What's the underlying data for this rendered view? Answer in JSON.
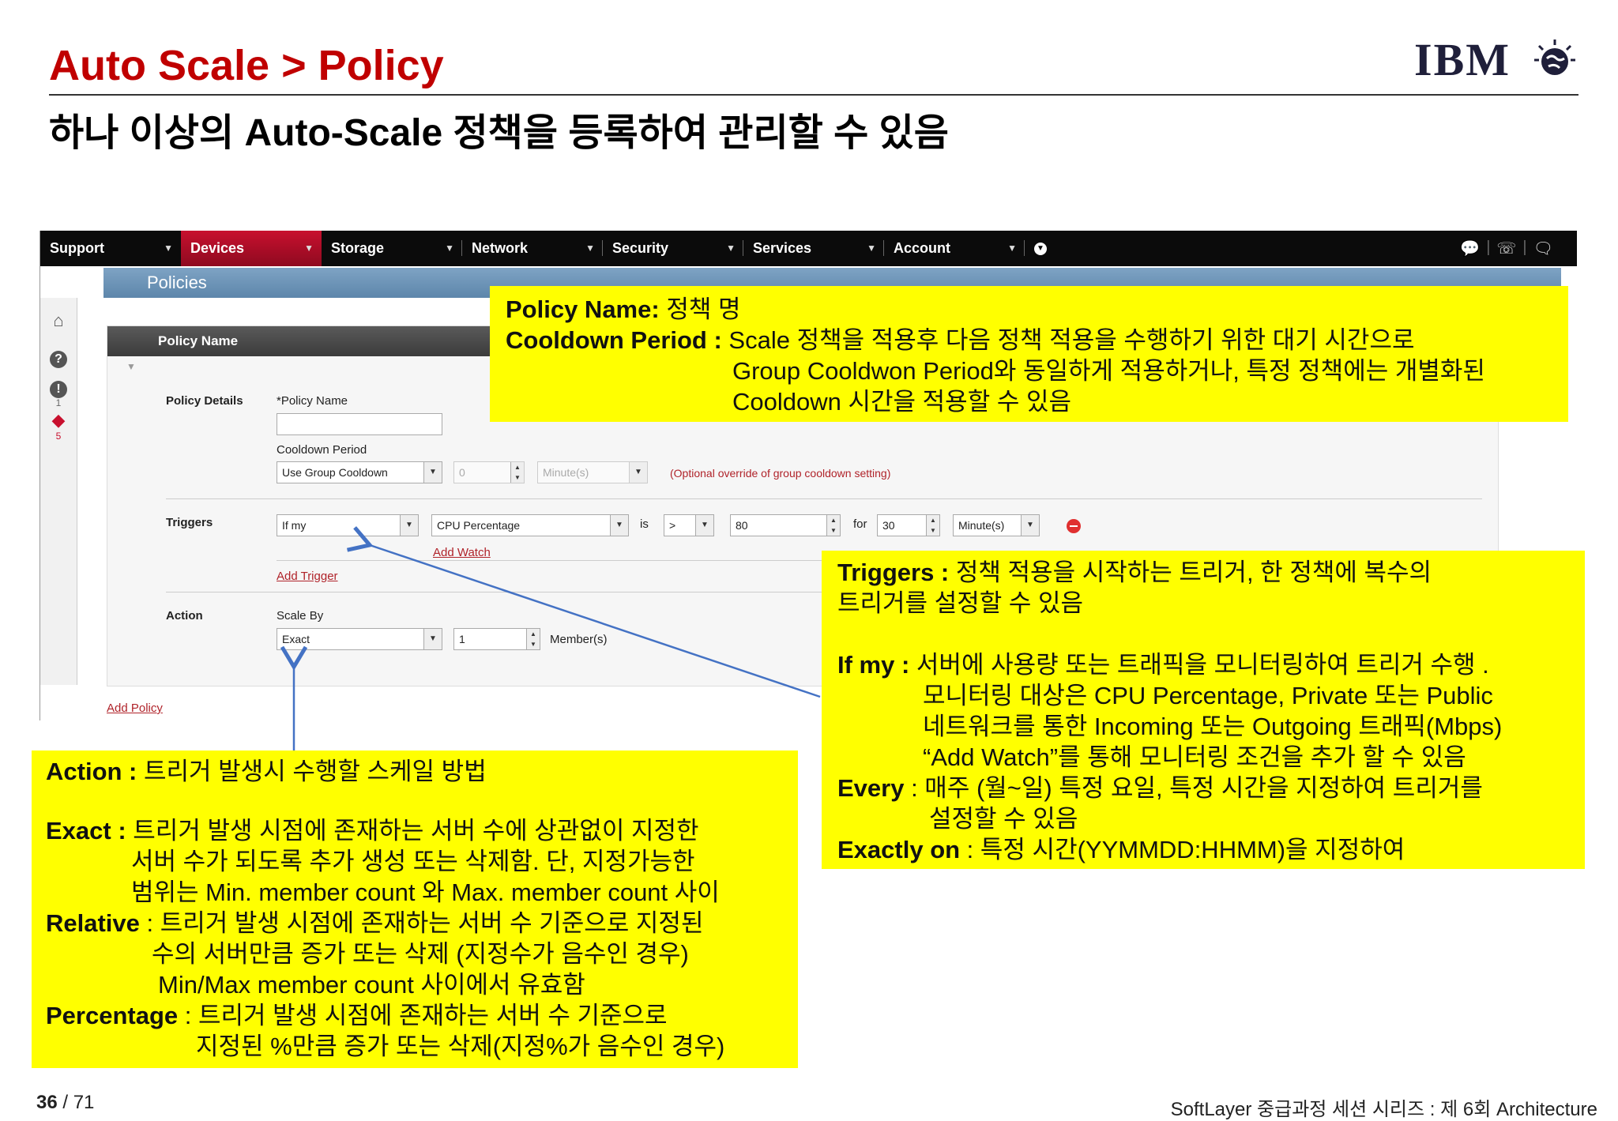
{
  "header": {
    "title": "Auto Scale > Policy",
    "subtitle": "하나 이상의 Auto-Scale 정책을 등록하여 관리할 수 있음",
    "logo_text": "IBM",
    "logo_icon": "globe-icon"
  },
  "navbar": {
    "items": [
      "Support",
      "Devices",
      "Storage",
      "Network",
      "Security",
      "Services",
      "Account"
    ],
    "active": "Devices",
    "right_icons": [
      "chat-icon",
      "phone-icon",
      "speech-icon"
    ]
  },
  "policies_bar": {
    "title": "Policies"
  },
  "side_icons": [
    {
      "icon": "home-icon",
      "count": ""
    },
    {
      "icon": "help-icon",
      "count": ""
    },
    {
      "icon": "alert-icon",
      "count": "1"
    },
    {
      "icon": "tag-icon",
      "count": "5"
    }
  ],
  "form": {
    "panel_header": "Policy Name",
    "policy_details_label": "Policy Details",
    "policy_name_label": "*Policy Name",
    "policy_name_value": "",
    "cooldown_label": "Cooldown Period",
    "cooldown_select": "Use Group Cooldown",
    "cooldown_value": "0",
    "cooldown_unit": "Minute(s)",
    "cooldown_note": "(Optional override of group cooldown setting)",
    "triggers_label": "Triggers",
    "trigger": {
      "type": "If my",
      "metric": "CPU Percentage",
      "is_label": "is",
      "operator": ">",
      "threshold": "80",
      "for_label": "for",
      "duration": "30",
      "unit": "Minute(s)"
    },
    "add_watch": "Add Watch",
    "add_trigger": "Add Trigger",
    "action_label": "Action",
    "scale_by_label": "Scale By",
    "scale_by_value": "Exact",
    "member_value": "1",
    "member_label": "Member(s)",
    "add_policy": "Add Policy"
  },
  "callout_policy": {
    "lines": [
      {
        "bold": "Policy Name:",
        "text": " 정책 명"
      },
      {
        "bold": "Cooldown Period :",
        "text": " Scale 정책을 적용후 다음 정책 적용을 수행하기 위한 대기 시간으로"
      },
      {
        "bold": "",
        "text": "Group Cooldwon Period와 동일하게 적용하거나, 특정 정책에는 개별화된"
      },
      {
        "bold": "",
        "text": "Cooldown 시간을 적용할 수 있음"
      }
    ]
  },
  "callout_triggers": {
    "lines": [
      {
        "bold": "Triggers :",
        "text": " 정책 적용을 시작하는 트리거, 한 정책에 복수의"
      },
      {
        "bold": "",
        "text": "트리거를 설정할 수 있음"
      },
      {
        "bold": "",
        "text": ""
      },
      {
        "bold": "If my :",
        "text": "  서버에 사용량 또는 트래픽을 모니터링하여 트리거 수행 ."
      },
      {
        "bold": "",
        "text": "모니터링 대상은 CPU Percentage, Private 또는 Public"
      },
      {
        "bold": "",
        "text": "네트워크를 통한 Incoming 또는 Outgoing 트래픽(Mbps)"
      },
      {
        "bold": "",
        "text": " “Add Watch”를 통해 모니터링 조건을 추가 할 수 있음"
      },
      {
        "bold": "Every",
        "text": " : 매주 (월~일) 특정 요일, 특정 시간을 지정하여 트리거를"
      },
      {
        "bold": "",
        "text": "설정할 수 있음"
      },
      {
        "bold": "Exactly on",
        "text": " : 특정 시간(YYMMDD:HHMM)을 지정하여"
      }
    ]
  },
  "callout_action": {
    "lines": [
      {
        "bold": "Action :",
        "text": " 트리거 발생시 수행할 스케일 방법"
      },
      {
        "bold": "",
        "text": ""
      },
      {
        "bold": "Exact :",
        "text": " 트리거 발생 시점에 존재하는 서버 수에 상관없이 지정한"
      },
      {
        "bold": "",
        "text": "서버 수가 되도록 추가 생성 또는 삭제함. 단, 지정가능한"
      },
      {
        "bold": "",
        "text": "범위는 Min. member count 와 Max. member count 사이"
      },
      {
        "bold": "Relative",
        "text": " : 트리거 발생 시점에 존재하는 서버 수 기준으로 지정된"
      },
      {
        "bold": "",
        "text": "수의 서버만큼 증가 또는 삭제 (지정수가 음수인 경우)"
      },
      {
        "bold": "",
        "text": "Min/Max member count  사이에서 유효함"
      },
      {
        "bold": "Percentage",
        "text": " : 트리거 발생 시점에 존재하는 서버 수 기준으로"
      },
      {
        "bold": "",
        "text": "지정된 %만큼 증가 또는 삭제(지정%가 음수인 경우)"
      }
    ]
  },
  "footer": {
    "page": "36",
    "total": " / 71",
    "series": "SoftLayer 중급과정 세션 시리즈 : 제 6회 Architecture"
  },
  "colors": {
    "title": "#c00000",
    "callout": "#ffff00",
    "arrow": "#4472c4",
    "nav_active": "#c8102e"
  }
}
